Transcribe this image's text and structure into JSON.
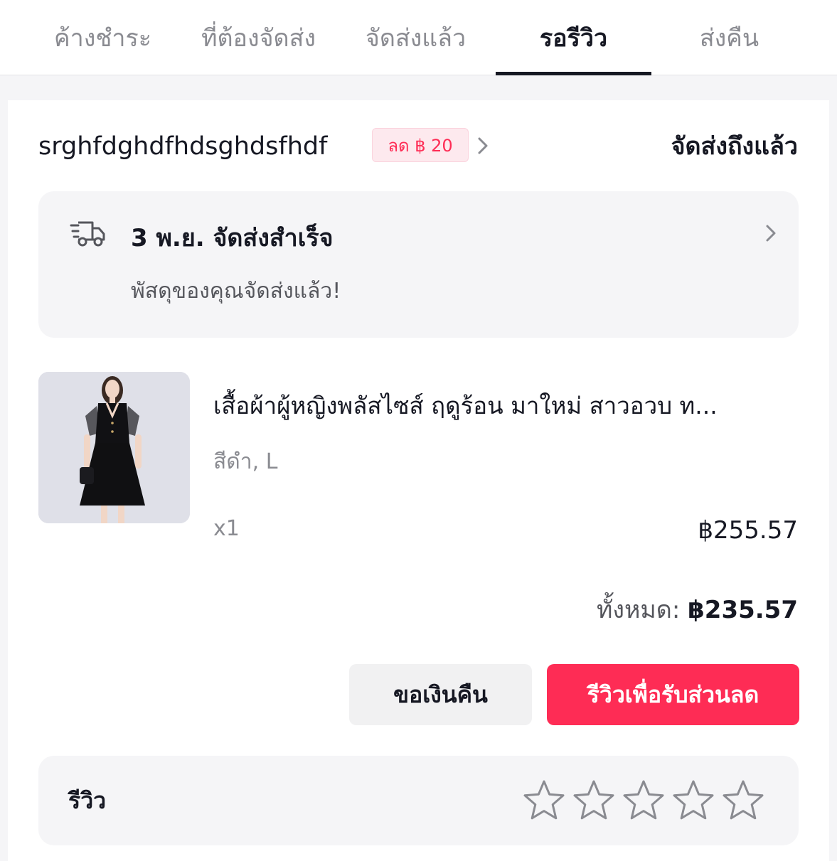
{
  "tabs": [
    {
      "label": "ค้างชำระ"
    },
    {
      "label": "ที่ต้องจัดส่ง"
    },
    {
      "label": "จัดส่งแล้ว"
    },
    {
      "label": "รอรีวิว"
    },
    {
      "label": "ส่งคืน"
    }
  ],
  "active_tab": "รอรีวิว",
  "order": {
    "shop_name": "srghfdghdfhdsghdsfhdf",
    "discount_badge": "ลด ฿ 20",
    "status": "จัดส่งถึงแล้ว",
    "delivery": {
      "title": "3 พ.ย. จัดส่งสำเร็จ",
      "subtitle": "พัสดุของคุณจัดส่งแล้ว!"
    },
    "product": {
      "title": "เสื้อผ้าผู้หญิงพลัสไซส์ ฤดูร้อน มาใหม่ สาวอวบ ท...",
      "variant": "สีดำ, L",
      "quantity": "x1",
      "price": "฿255.57"
    },
    "total": {
      "label": "ทั้งหมด:",
      "value": "฿235.57"
    },
    "buttons": {
      "refund": "ขอเงินคืน",
      "review": "รีวิวเพื่อรับส่วนลด"
    },
    "review": {
      "label": "รีวิว",
      "rating": 0,
      "max_rating": 5
    }
  },
  "colors": {
    "accent": "#fe2c55",
    "text_primary": "#161823",
    "text_secondary": "#8a8b91",
    "badge_bg": "#fde9ee",
    "panel_bg": "#f5f5f7"
  },
  "icons": {
    "shop_chevron": "chevron-right-icon",
    "delivery": "delivery-truck-icon",
    "delivery_chevron": "chevron-right-icon",
    "star": "star-outline-icon"
  }
}
